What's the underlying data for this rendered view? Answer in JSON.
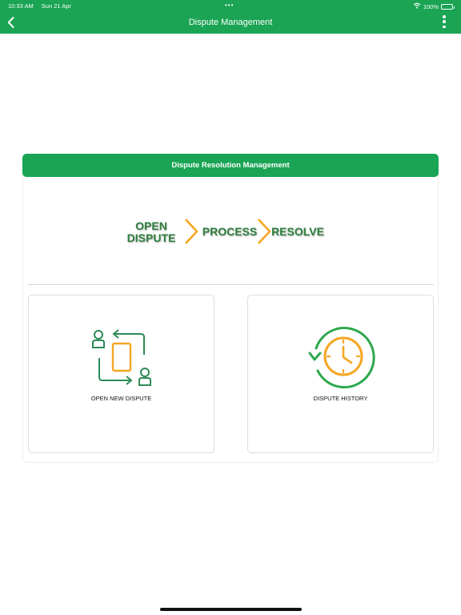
{
  "status_bar": {
    "time": "10:33 AM",
    "date": "Sun 21 Apr",
    "dots": "•••",
    "battery": "100%",
    "icons": [
      "wifi-icon",
      "battery-icon"
    ]
  },
  "header": {
    "title": "Dispute Management",
    "icons": [
      "chevron-left-icon",
      "more-vertical-icon"
    ]
  },
  "card": {
    "title": "Dispute Resolution Management",
    "flow": {
      "step1_line1": "OPEN",
      "step1_line2": "DISPUTE",
      "step2": "PROCESS",
      "step3": "RESOLVE"
    },
    "tiles": [
      {
        "label": "OPEN NEW DISPUTE",
        "icon": "exchange-users-icon"
      },
      {
        "label": "DISPUTE HISTORY",
        "icon": "history-clock-icon"
      }
    ]
  },
  "colors": {
    "primary": "#1aa454",
    "accent_orange": "#f5a623",
    "flow_green": "#2e7d3e",
    "icon_green": "#2e8b57"
  }
}
